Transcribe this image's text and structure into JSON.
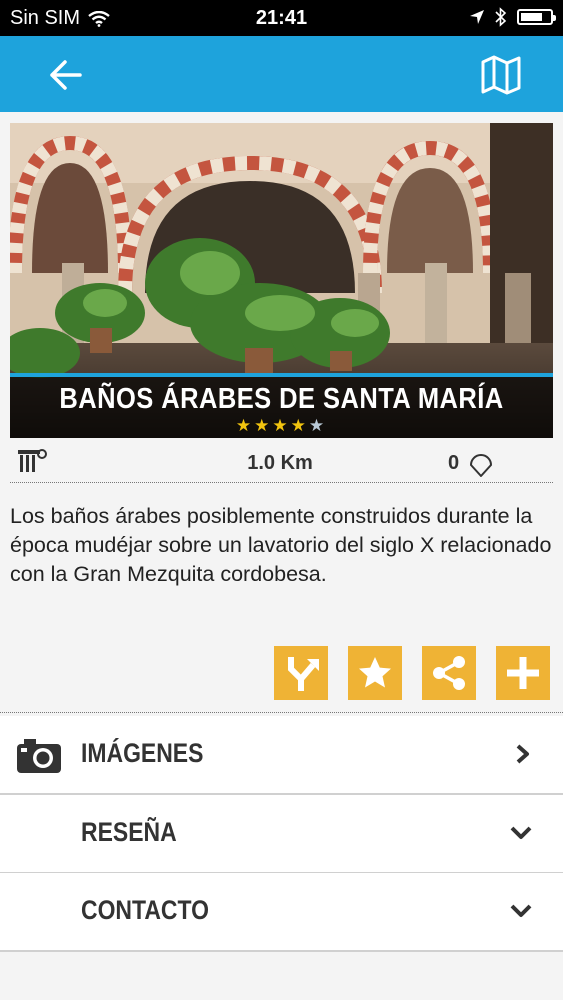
{
  "status_bar": {
    "carrier": "Sin SIM",
    "time": "21:41",
    "battery_level": 0.75
  },
  "header": {
    "back_icon": "arrow-left-icon",
    "map_icon": "map-icon",
    "accent_color": "#1ea3dc"
  },
  "place": {
    "title": "BAÑOS ÁRABES DE SANTA MARÍA",
    "rating": 4,
    "rating_max": 5,
    "category_icon": "monument-icon",
    "distance": "1.0 Km",
    "likes": "0",
    "description": "Los baños árabes posiblemente construidos durante la época mudéjar sobre un lavatorio del siglo X relacionado con la Gran Mezquita cordobesa."
  },
  "actions": [
    {
      "name": "directions-button",
      "icon": "directions-icon"
    },
    {
      "name": "favorite-button",
      "icon": "star-icon"
    },
    {
      "name": "share-button",
      "icon": "share-icon"
    },
    {
      "name": "add-button",
      "icon": "plus-icon"
    }
  ],
  "action_color": "#efb335",
  "sections": {
    "images": "IMÁGENES",
    "review": "RESEÑA",
    "contact": "CONTACTO"
  }
}
